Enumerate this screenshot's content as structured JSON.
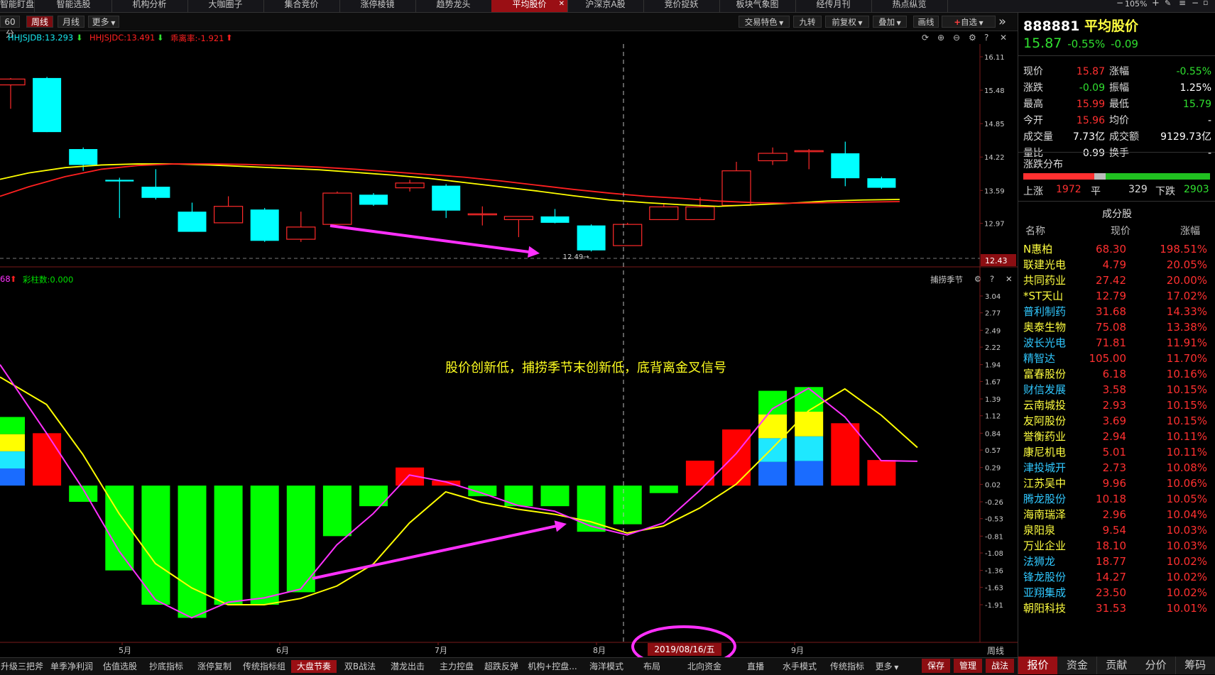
{
  "top_tabs": [
    "智能盯盘",
    "智能选股",
    "机构分析",
    "大咖圈子",
    "集合竞价",
    "涨停棱镜",
    "趋势龙头",
    "平均股价",
    "沪深京A股",
    "竞价捉妖",
    "板块气象图",
    "经传月刊",
    "热点纵览"
  ],
  "active_top_tab": "平均股价",
  "top_right": {
    "zoom": "105%",
    "plus": "+",
    "menu": "≡"
  },
  "toolbar": {
    "periods": [
      "60分",
      "周线",
      "月线",
      "更多"
    ],
    "active_period": "周线",
    "right_buttons": [
      "交易特色",
      "九转",
      "前复权",
      "叠加",
      "画线",
      "自选"
    ],
    "expand": "»"
  },
  "price_indicators": [
    {
      "text": "HHJSJDB:13.293",
      "color": "#17e8f0"
    },
    {
      "text": "HHJSJDC:13.491",
      "color": "#ff2020"
    },
    {
      "text": "乖离率:-1.921",
      "color": "#ff2020"
    }
  ],
  "price_axis": [
    "16.11",
    "15.48",
    "14.85",
    "14.22",
    "13.59",
    "12.97"
  ],
  "price_current_label": "12.43",
  "low_marker": "12.49",
  "lower_indicators": [
    {
      "text": "68",
      "color": "#ff30ff"
    },
    {
      "text": "彩柱数:0.000",
      "color": "#00e000"
    }
  ],
  "lower_title": "捕捞季节",
  "lower_axis": [
    "3.04",
    "2.77",
    "2.49",
    "2.22",
    "1.94",
    "1.67",
    "1.39",
    "1.12",
    "0.84",
    "0.57",
    "0.29",
    "0.02",
    "-0.26",
    "-0.53",
    "-0.81",
    "-1.08",
    "-1.36",
    "-1.63",
    "-1.91"
  ],
  "annotation": "股价创新低，捕捞季节末创新低，底背离金叉信号",
  "x_months": [
    "5月",
    "6月",
    "7月",
    "8月",
    "9月"
  ],
  "crosshair_date": "2019/08/16/五",
  "x_axis_unit": "周线",
  "stock": {
    "code": "888881",
    "name": "平均股价",
    "price": "15.87",
    "change_pct": "-0.55%",
    "change": "-0.09"
  },
  "quote": [
    {
      "l1": "现价",
      "v1": "15.87",
      "c1": "#ff3030",
      "l2": "涨幅",
      "v2": "-0.55%",
      "c2": "#30e030"
    },
    {
      "l1": "涨跌",
      "v1": "-0.09",
      "c1": "#30e030",
      "l2": "振幅",
      "v2": "1.25%",
      "c2": "#ffffff"
    },
    {
      "l1": "最高",
      "v1": "15.99",
      "c1": "#ff3030",
      "l2": "最低",
      "v2": "15.79",
      "c2": "#30e030"
    },
    {
      "l1": "今开",
      "v1": "15.96",
      "c1": "#ff3030",
      "l2": "均价",
      "v2": "-",
      "c2": "#ffffff"
    },
    {
      "l1": "成交量",
      "v1": "7.73亿",
      "c1": "#ffffff",
      "l2": "成交额",
      "v2": "9129.73亿",
      "c2": "#ffffff"
    },
    {
      "l1": "量比",
      "v1": "0.99",
      "c1": "#ffffff",
      "l2": "换手",
      "v2": "-",
      "c2": "#ffffff"
    }
  ],
  "distribution": {
    "title": "涨跌分布",
    "up_label": "上涨",
    "up": "1972",
    "flat_label": "平",
    "flat": "329",
    "down_label": "下跌",
    "down": "2903",
    "up_frac": 0.379,
    "flat_frac": 0.063,
    "down_frac": 0.558
  },
  "constituents": {
    "title": "成分股",
    "headers": [
      "名称",
      "现价",
      "涨幅"
    ],
    "rows": [
      {
        "name": "N惠柏",
        "price": "68.30",
        "pct": "198.51%",
        "nc": "#ffff40"
      },
      {
        "name": "联建光电",
        "price": "4.79",
        "pct": "20.05%",
        "nc": "#ffff40"
      },
      {
        "name": "共同药业",
        "price": "27.42",
        "pct": "20.00%",
        "nc": "#ffff40"
      },
      {
        "name": "*ST天山",
        "price": "12.79",
        "pct": "17.02%",
        "nc": "#ffff40"
      },
      {
        "name": "普利制药",
        "price": "31.68",
        "pct": "14.33%",
        "nc": "#30c8ff"
      },
      {
        "name": "奥泰生物",
        "price": "75.08",
        "pct": "13.38%",
        "nc": "#ffff40"
      },
      {
        "name": "波长光电",
        "price": "71.81",
        "pct": "11.91%",
        "nc": "#30c8ff"
      },
      {
        "name": "精智达",
        "price": "105.00",
        "pct": "11.70%",
        "nc": "#30c8ff"
      },
      {
        "name": "富春股份",
        "price": "6.18",
        "pct": "10.16%",
        "nc": "#ffff40"
      },
      {
        "name": "财信发展",
        "price": "3.58",
        "pct": "10.15%",
        "nc": "#30c8ff"
      },
      {
        "name": "云南城投",
        "price": "2.93",
        "pct": "10.15%",
        "nc": "#ffff40"
      },
      {
        "name": "友阿股份",
        "price": "3.69",
        "pct": "10.15%",
        "nc": "#ffff40"
      },
      {
        "name": "誉衡药业",
        "price": "2.94",
        "pct": "10.11%",
        "nc": "#ffff40"
      },
      {
        "name": "康尼机电",
        "price": "5.01",
        "pct": "10.11%",
        "nc": "#ffff40"
      },
      {
        "name": "津投城开",
        "price": "2.73",
        "pct": "10.08%",
        "nc": "#30c8ff"
      },
      {
        "name": "江苏吴中",
        "price": "9.96",
        "pct": "10.06%",
        "nc": "#ffff40"
      },
      {
        "name": "腾龙股份",
        "price": "10.18",
        "pct": "10.05%",
        "nc": "#30c8ff"
      },
      {
        "name": "海南瑞泽",
        "price": "2.96",
        "pct": "10.04%",
        "nc": "#ffff40"
      },
      {
        "name": "泉阳泉",
        "price": "9.54",
        "pct": "10.03%",
        "nc": "#ffff40"
      },
      {
        "name": "万业企业",
        "price": "18.10",
        "pct": "10.03%",
        "nc": "#ffff40"
      },
      {
        "name": "法狮龙",
        "price": "18.77",
        "pct": "10.02%",
        "nc": "#30c8ff"
      },
      {
        "name": "锋龙股份",
        "price": "14.27",
        "pct": "10.02%",
        "nc": "#30c8ff"
      },
      {
        "name": "亚翔集成",
        "price": "23.50",
        "pct": "10.02%",
        "nc": "#30c8ff"
      },
      {
        "name": "朝阳科技",
        "price": "31.53",
        "pct": "10.01%",
        "nc": "#ffff40"
      }
    ]
  },
  "bottom_tabs": [
    "升级三把斧",
    "单季净利润",
    "估值选股",
    "抄底指标",
    "涨停复制",
    "传统指标组",
    "大盘节奏",
    "双B战法",
    "潜龙出击",
    "主力控盘",
    "超跌反弹",
    "机构+控盘...",
    "海洋模式",
    "布局",
    "北向资金",
    "直播",
    "水手模式",
    "传统指标",
    "更多"
  ],
  "active_bottom_tab": "大盘节奏",
  "action_buttons": [
    "保存",
    "管理",
    "战法"
  ],
  "right_tabs": [
    "报价",
    "资金",
    "贡献",
    "分价",
    "筹码"
  ],
  "active_right_tab": "报价",
  "chart_data": [
    {
      "type": "candlestick",
      "title": "",
      "period": "周线",
      "candles": [
        {
          "o": 15.69,
          "c": 15.58,
          "h": 15.71,
          "l": 15.13,
          "up": true
        },
        {
          "o": 15.71,
          "c": 14.69,
          "h": 15.73,
          "l": 14.69,
          "up": false
        },
        {
          "o": 14.37,
          "c": 14.07,
          "h": 14.4,
          "l": 13.96,
          "up": false
        },
        {
          "o": 13.79,
          "c": 13.76,
          "h": 13.83,
          "l": 13.07,
          "up": false
        },
        {
          "o": 13.66,
          "c": 13.45,
          "h": 13.99,
          "l": 13.42,
          "up": false
        },
        {
          "o": 13.19,
          "c": 12.81,
          "h": 13.36,
          "l": 12.81,
          "up": false
        },
        {
          "o": 12.98,
          "c": 13.29,
          "h": 13.48,
          "l": 12.98,
          "up": true
        },
        {
          "o": 13.23,
          "c": 12.64,
          "h": 13.26,
          "l": 12.62,
          "up": false
        },
        {
          "o": 12.67,
          "c": 12.9,
          "h": 13.19,
          "l": 12.62,
          "up": true
        },
        {
          "o": 12.95,
          "c": 13.54,
          "h": 13.57,
          "l": 12.95,
          "up": true
        },
        {
          "o": 13.51,
          "c": 13.32,
          "h": 13.54,
          "l": 13.3,
          "up": false
        },
        {
          "o": 13.64,
          "c": 13.73,
          "h": 13.79,
          "l": 13.57,
          "up": true
        },
        {
          "o": 13.68,
          "c": 13.21,
          "h": 13.71,
          "l": 13.07,
          "up": false
        },
        {
          "o": 13.13,
          "c": 13.15,
          "h": 13.29,
          "l": 12.93,
          "up": true
        },
        {
          "o": 13.04,
          "c": 13.1,
          "h": 13.1,
          "l": 12.71,
          "up": true
        },
        {
          "o": 13.1,
          "c": 12.98,
          "h": 13.24,
          "l": 12.97,
          "up": false
        },
        {
          "o": 12.93,
          "c": 12.46,
          "h": 12.95,
          "l": 12.44,
          "up": false
        },
        {
          "o": 12.55,
          "c": 12.95,
          "h": 12.98,
          "l": 12.55,
          "up": true
        },
        {
          "o": 13.04,
          "c": 13.28,
          "h": 13.35,
          "l": 13.04,
          "up": true
        },
        {
          "o": 13.04,
          "c": 13.28,
          "h": 13.46,
          "l": 13.04,
          "up": true
        },
        {
          "o": 13.31,
          "c": 13.96,
          "h": 14.13,
          "l": 13.31,
          "up": true
        },
        {
          "o": 14.15,
          "c": 14.29,
          "h": 14.4,
          "l": 14.07,
          "up": true
        },
        {
          "o": 14.34,
          "c": 14.34,
          "h": 14.37,
          "l": 13.99,
          "up": true
        },
        {
          "o": 14.29,
          "c": 13.82,
          "h": 14.51,
          "l": 13.67,
          "up": false
        },
        {
          "o": 13.82,
          "c": 13.64,
          "h": 13.85,
          "l": 13.62,
          "up": false
        }
      ],
      "series": [
        {
          "name": "HHJSJDB",
          "color": "#ffff00",
          "values": [
            13.8,
            13.92,
            14.02,
            14.07,
            14.09,
            14.09,
            14.07,
            14.04,
            14.01,
            13.98,
            13.93,
            13.88,
            13.82,
            13.74,
            13.66,
            13.58,
            13.49,
            13.41,
            13.36,
            13.32,
            13.29,
            13.32,
            13.35,
            13.39,
            13.41,
            13.42
          ]
        },
        {
          "name": "HHJSJDC",
          "color": "#ff2020",
          "values": [
            13.48,
            13.66,
            13.85,
            13.99,
            14.06,
            14.09,
            14.09,
            14.08,
            14.06,
            14.03,
            13.99,
            13.94,
            13.89,
            13.84,
            13.77,
            13.69,
            13.61,
            13.54,
            13.48,
            13.44,
            13.39,
            13.36,
            13.35,
            13.36,
            13.37,
            13.38
          ]
        }
      ],
      "ylim": [
        12.4,
        16.11
      ]
    },
    {
      "type": "bar",
      "title": "捕捞季节",
      "values": [
        1.1,
        0.84,
        -0.26,
        -1.36,
        -1.91,
        -2.12,
        -1.91,
        -1.91,
        -1.71,
        -0.81,
        -0.33,
        0.29,
        0.08,
        -0.17,
        -0.33,
        -0.33,
        -0.74,
        -0.62,
        -0.12,
        0.4,
        0.9,
        1.52,
        1.58,
        1.0,
        0.41
      ],
      "bar_colors": [
        "stack",
        "#ff0000",
        "#00ff00",
        "#00ff00",
        "#00ff00",
        "#00ff00",
        "#00ff00",
        "#00ff00",
        "#00ff00",
        "#00ff00",
        "#00ff00",
        "#ff0000",
        "#ff0000",
        "#00ff00",
        "#00ff00",
        "#00ff00",
        "#00ff00",
        "#00ff00",
        "#00ff00",
        "#ff0000",
        "#ff0000",
        "stack",
        "stack",
        "#ff0000",
        "#ff0000"
      ],
      "series": [
        {
          "name": "",
          "color": "#ffff00",
          "values": [
            1.74,
            1.3,
            0.5,
            -0.45,
            -1.25,
            -1.64,
            -1.91,
            -1.91,
            -1.81,
            -1.61,
            -1.26,
            -0.6,
            -0.1,
            -0.27,
            -0.38,
            -0.46,
            -0.58,
            -0.76,
            -0.65,
            -0.36,
            0.02,
            0.6,
            1.2,
            1.55,
            1.13,
            0.61
          ]
        },
        {
          "name": "",
          "color": "#ff30ff",
          "values": [
            1.94,
            0.84,
            -0.05,
            -1.05,
            -1.83,
            -2.12,
            -1.87,
            -1.8,
            -1.66,
            -0.95,
            -0.45,
            0.17,
            0.06,
            -0.12,
            -0.32,
            -0.41,
            -0.65,
            -0.79,
            -0.6,
            -0.08,
            0.51,
            1.23,
            1.56,
            1.1,
            0.4,
            0.39
          ]
        }
      ],
      "ylim": [
        -2.25,
        3.04
      ]
    }
  ]
}
